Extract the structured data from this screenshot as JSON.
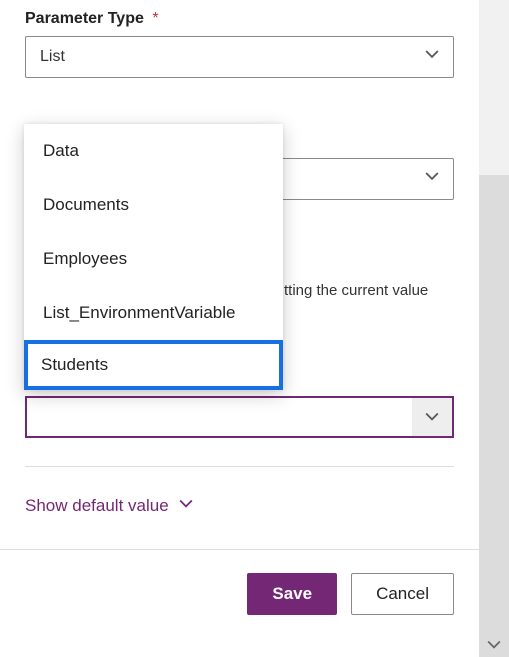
{
  "param_type": {
    "label": "Parameter Type",
    "required_mark": "*",
    "value": "List"
  },
  "second_select": {
    "value": ""
  },
  "helper_fragment": "tting the current value",
  "dropdown": {
    "options": [
      "Data",
      "Documents",
      "Employees",
      "List_EnvironmentVariable",
      "Students"
    ]
  },
  "current_list": {
    "value": ""
  },
  "show_default_label": "Show default value",
  "buttons": {
    "save": "Save",
    "cancel": "Cancel"
  }
}
